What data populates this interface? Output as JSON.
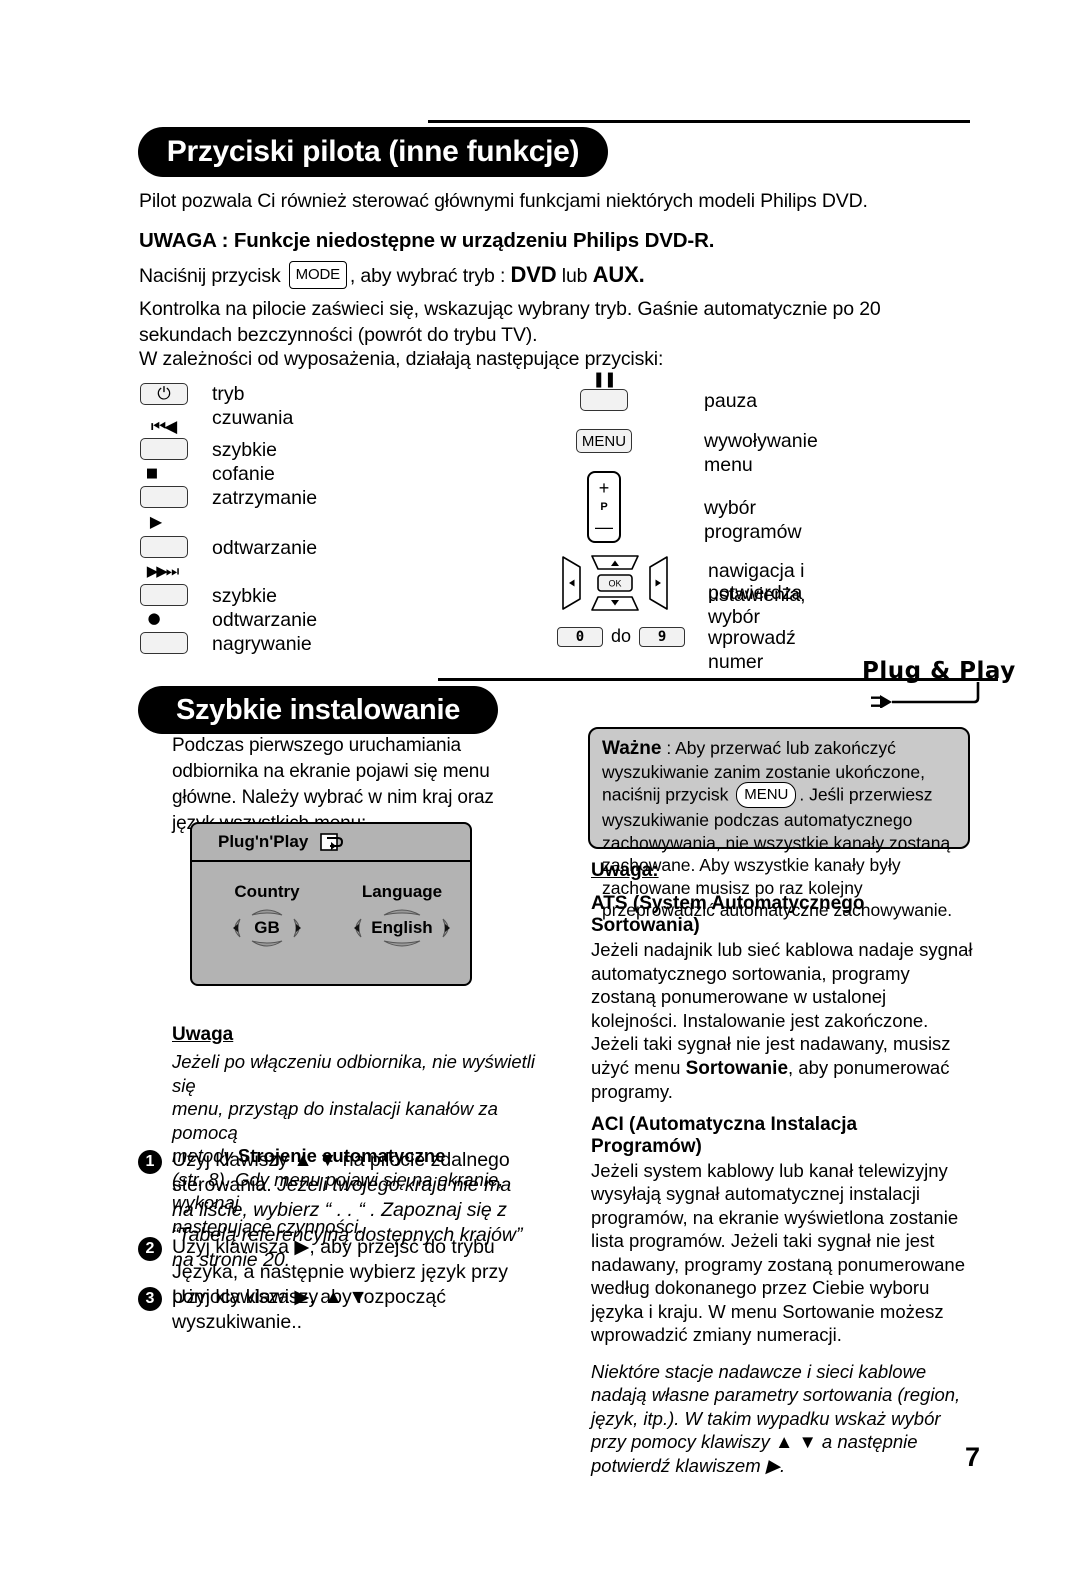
{
  "page": {
    "number": "7"
  },
  "section1": {
    "banner_title": "Przyciski pilota (inne funkcje)",
    "intro": "Pilot pozwala Ci również sterować głównymi funkcjami niektórych modeli Philips DVD.",
    "note_heading": "UWAGA : Funkcje niedostępne w urządzeniu Philips DVD-R.",
    "mode_line_pre": "Naciśnij przycisk",
    "mode_key": "MODE",
    "mode_line_mid": ", aby wybrać tryb :",
    "mode_dvd": "DVD",
    "mode_lub": "lub",
    "mode_aux": "AUX.",
    "paragraph2": "Kontrolka na  pilocie zaświeci się, wskazując wybrany tryb. Gaśnie automatycznie po 20 sekundach bezczynności (powrót do trybu TV).",
    "paragraph3": "W zależności od wyposażenia, działają następujące przyciski:"
  },
  "buttons_left": [
    {
      "glyph": "⏻",
      "icon_name": "power-icon",
      "label": "tryb czuwania",
      "glyph_inside": true
    },
    {
      "glyph": "⏮◀",
      "icon_name": "rewind-icon",
      "label": "szybkie cofanie",
      "glyph_inside": false
    },
    {
      "glyph": "■",
      "icon_name": "stop-icon",
      "label": "zatrzymanie",
      "glyph_inside": false
    },
    {
      "glyph": "▶",
      "icon_name": "play-icon",
      "label": "odtwarzanie",
      "glyph_inside": false
    },
    {
      "glyph": "▶▶⏭",
      "icon_name": "fast-forward-icon",
      "label": "szybkie odtwarzanie",
      "glyph_inside": false
    },
    {
      "glyph": "●",
      "icon_name": "record-icon",
      "label": "nagrywanie",
      "glyph_inside": false
    }
  ],
  "buttons_right": [
    {
      "kind": "blank",
      "glyph": "❚❚",
      "icon_name": "pause-icon",
      "label": "pauza"
    },
    {
      "kind": "menu",
      "text": "MENU",
      "icon_name": "menu-key",
      "label": "wywoływanie menu"
    },
    {
      "kind": "prog",
      "plus": "+",
      "p": "P",
      "minus": "—",
      "icon_name": "program-rocker",
      "label": "wybór programów"
    },
    {
      "kind": "navpad",
      "ok": "OK",
      "icon_name": "navigation-pad",
      "label_line1": "nawigacja i ustawienia,",
      "label_line2": "potwierdza wybór"
    },
    {
      "kind": "numbers",
      "from": "0",
      "to": "9",
      "do_word": "do",
      "icon_name": "number-keys",
      "label": "wprowadź numer"
    }
  ],
  "section2": {
    "banner_title": "Szybkie instalowanie",
    "logo_text": "Plug & Play",
    "intro": "Podczas pierwszego uruchamiania odbiornika na ekranie pojawi się menu główne. Należy wybrać w nim kraj oraz język wszystkich menu:"
  },
  "screen_mock": {
    "title": "Plug'n'Play",
    "icon_name": "return-arrow-icon",
    "country_label": "Country",
    "country_value": "GB",
    "language_label": "Language",
    "language_value": "English"
  },
  "left_note": {
    "heading": "Uwaga",
    "line1": "Jeżeli po włączeniu odbiornika, nie wyświetli się",
    "line2": "menu, przystąp do instalacji kanałów za pomocą",
    "line3_pre": "metody ",
    "line3_bold": "Strojenie automatyczne",
    "line4": "(str. 8). Gdy menu pojawi się na ekranie, wykonaj",
    "line5": "następujące czynności."
  },
  "steps": [
    {
      "num": "1",
      "line1": "Użyj klawiszy ▲ ▼ na pilocie zdalnego sterowania.",
      "italic": "Jeżeli twojego kraju nie ma na liście, wybierz “ . . “ . Zapoznaj się z “Tabelą referencyjną dostępnych krajów” na stronie 20."
    },
    {
      "num": "2",
      "line1": "Użyj klawisza ▶, aby przejść do trybu Języka, a następnie wybierz język przy pomocy klawiszy ▲ ▼.",
      "italic": ""
    },
    {
      "num": "3",
      "line1": "Użyj klawisza ▶, aby rozpocząć wyszukiwanie..",
      "italic": ""
    }
  ],
  "wazne_box": {
    "heading": "Ważne",
    "text_pre": " : Aby przerwać lub zakończyć wyszukiwanie zanim zostanie ukończone, naciśnij przycisk",
    "menu_key": "MENU",
    "text_post": ".",
    "body": "Jeśli przerwiesz wyszukiwanie podczas automatycznego zachowywania, nie wszystkie kanały zostaną zachowane. Aby wszystkie kanały były zachowane musisz po raz kolejny przeprowadzić automatyczne zachowywanie."
  },
  "right_note": {
    "heading": "Uwaga:",
    "ats_title": "ATS (System Automatycznego Sortowania)",
    "ats_pre": "Jeżeli nadajnik lub sieć kablowa nadaje sygnał automatycznego sortowania, programy zostaną ponumerowane w ustalonej kolejności. Instalowanie jest zakończone. Jeżeli taki sygnał nie jest nadawany, musisz użyć menu ",
    "ats_bold": "Sortowanie",
    "ats_post": ", aby ponumerować programy.",
    "aci_title": "ACI (Automatyczna Instalacja Programów)",
    "aci_text": "Jeżeli system kablowy lub kanał telewizyjny wysyłają sygnał automatycznej instalacji programów, na ekranie wyświetlona zostanie lista programów. Jeżeli taki sygnał nie jest nadawany, programy zostaną ponumerowane według dokonanego przez Ciebie wyboru języka i kraju. W menu Sortowanie możesz wprowadzić zmiany numeracji.",
    "final_italic": "Niektóre stacje nadawcze i sieci kablowe nadają własne parametry sortowania (region, język, itp.). W takim wypadku wskaż wybór przy pomocy klawiszy ▲ ▼ a następnie potwierdź klawiszem ▶."
  }
}
